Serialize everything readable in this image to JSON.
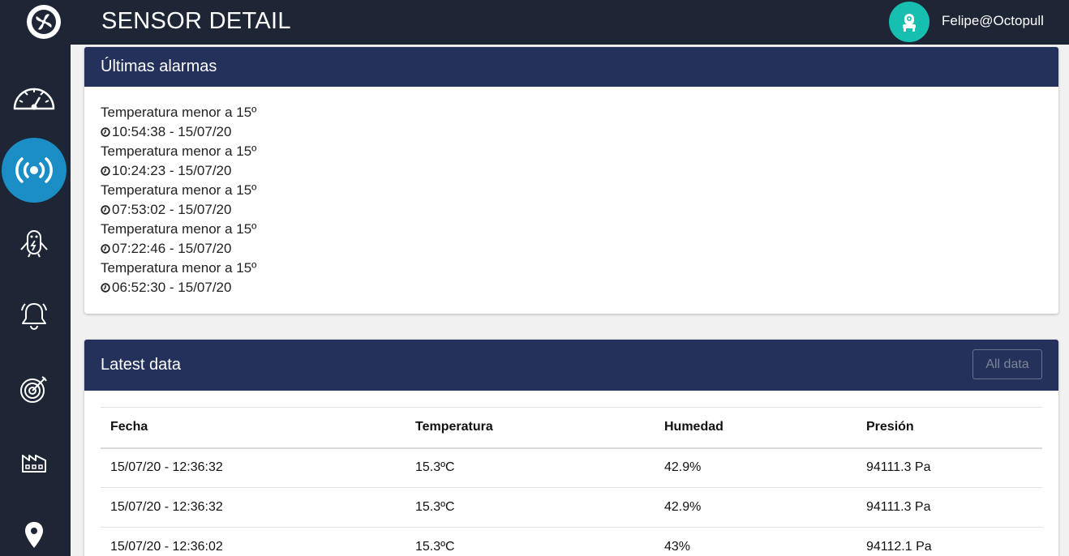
{
  "header": {
    "title": "SENSOR DETAIL",
    "user": "Felipe@Octopull"
  },
  "sidebar": {
    "items": [
      {
        "name": "dashboard",
        "icon": "gauge-icon",
        "active": false
      },
      {
        "name": "sensors",
        "icon": "broadcast-icon",
        "active": true
      },
      {
        "name": "devices",
        "icon": "robot-icon",
        "active": false
      },
      {
        "name": "alarms",
        "icon": "bell-icon",
        "active": false
      },
      {
        "name": "targets",
        "icon": "target-icon",
        "active": false
      },
      {
        "name": "plants",
        "icon": "factory-icon",
        "active": false
      },
      {
        "name": "locations",
        "icon": "map-pin-icon",
        "active": false
      }
    ]
  },
  "alarms": {
    "title": "Últimas alarmas",
    "items": [
      {
        "text": "Temperatura menor a 15º",
        "time": "10:54:38 - 15/07/20"
      },
      {
        "text": "Temperatura menor a 15º",
        "time": "10:24:23 - 15/07/20"
      },
      {
        "text": "Temperatura menor a 15º",
        "time": "07:53:02 - 15/07/20"
      },
      {
        "text": "Temperatura menor a 15º",
        "time": "07:22:46 - 15/07/20"
      },
      {
        "text": "Temperatura menor a 15º",
        "time": "06:52:30 - 15/07/20"
      }
    ]
  },
  "latest": {
    "title": "Latest data",
    "button": "All data",
    "columns": [
      "Fecha",
      "Temperatura",
      "Humedad",
      "Presión"
    ],
    "rows": [
      [
        "15/07/20 - 12:36:32",
        "15.3ºC",
        "42.9%",
        "94111.3 Pa"
      ],
      [
        "15/07/20 - 12:36:32",
        "15.3ºC",
        "42.9%",
        "94111.3 Pa"
      ],
      [
        "15/07/20 - 12:36:02",
        "15.3ºC",
        "43%",
        "94112.1 Pa"
      ]
    ]
  },
  "colors": {
    "topbar": "#1e2636",
    "card_header": "#24315a",
    "active_nav": "#1a8ec5",
    "avatar": "#17bfb0"
  }
}
